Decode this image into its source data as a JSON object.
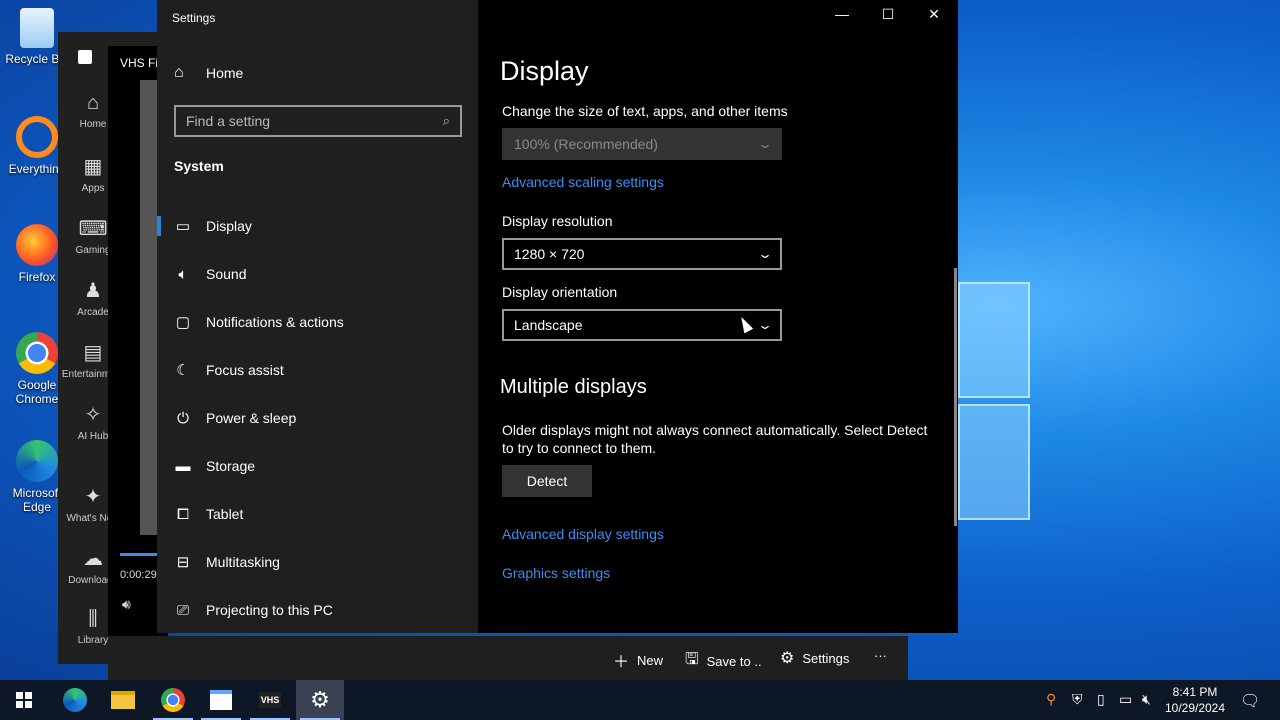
{
  "desktop": {
    "icons": [
      {
        "label": "Recycle Bin",
        "icon": "recycle-bin-icon"
      },
      {
        "label": "Everything",
        "icon": "everything-icon"
      },
      {
        "label": "Firefox",
        "icon": "firefox-icon"
      },
      {
        "label": "Google Chrome",
        "icon": "chrome-icon"
      },
      {
        "label": "Microsoft Edge",
        "icon": "edge-icon"
      }
    ]
  },
  "bg_app": {
    "title": "VHS Fil",
    "nav": [
      {
        "label": "Home",
        "icon": "home-icon"
      },
      {
        "label": "Apps",
        "icon": "apps-icon"
      },
      {
        "label": "Gaming",
        "icon": "gaming-icon"
      },
      {
        "label": "Arcade",
        "icon": "arcade-icon"
      },
      {
        "label": "Entertainment",
        "icon": "entertainment-icon"
      },
      {
        "label": "AI Hub",
        "icon": "ai-hub-icon"
      },
      {
        "label": "What's New",
        "icon": "whats-new-icon"
      },
      {
        "label": "Downloads",
        "icon": "downloads-icon"
      },
      {
        "label": "Library",
        "icon": "library-icon"
      }
    ],
    "time": "0:00:29",
    "progress": 0.05,
    "commands": {
      "new": "New",
      "save": "Save to ..",
      "settings": "Settings",
      "more": "···"
    }
  },
  "settings": {
    "window_title": "Settings",
    "home_label": "Home",
    "search_placeholder": "Find a setting",
    "section": "System",
    "nav": [
      {
        "label": "Display",
        "icon": "display-icon",
        "active": true
      },
      {
        "label": "Sound",
        "icon": "sound-icon"
      },
      {
        "label": "Notifications & actions",
        "icon": "notifications-icon"
      },
      {
        "label": "Focus assist",
        "icon": "focus-assist-icon"
      },
      {
        "label": "Power & sleep",
        "icon": "power-icon"
      },
      {
        "label": "Storage",
        "icon": "storage-icon"
      },
      {
        "label": "Tablet",
        "icon": "tablet-icon"
      },
      {
        "label": "Multitasking",
        "icon": "multitasking-icon"
      },
      {
        "label": "Projecting to this PC",
        "icon": "projecting-icon"
      }
    ],
    "page": {
      "title": "Display",
      "scale_label": "Change the size of text, apps, and other items",
      "scale_value": "100% (Recommended)",
      "advanced_scaling": "Advanced scaling settings",
      "resolution_label": "Display resolution",
      "resolution_value": "1280 × 720",
      "orientation_label": "Display orientation",
      "orientation_value": "Landscape",
      "multiple_title": "Multiple displays",
      "multiple_desc_1": "Older displays might not always connect automatically. Select Detect",
      "multiple_desc_2": "to try to connect to them.",
      "detect_button": "Detect",
      "advanced_display": "Advanced display settings",
      "graphics": "Graphics settings"
    }
  },
  "taskbar": {
    "time": "8:41 PM",
    "date": "10/29/2024",
    "apps": [
      "start-icon",
      "edge-icon",
      "file-explorer-icon",
      "chrome-icon",
      "store-icon",
      "vhs-icon",
      "settings-icon"
    ],
    "vhs_label": "VHS"
  }
}
